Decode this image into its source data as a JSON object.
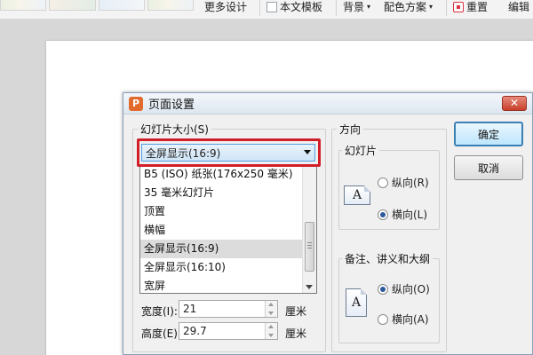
{
  "ribbon": {
    "more_designs": "更多设计",
    "text_template": "本文模板",
    "background": "背景",
    "color_scheme": "配色方案",
    "reset": "重置",
    "edit": "编辑"
  },
  "dialog": {
    "title": "页面设置",
    "close": "✕",
    "slide_size_group": "幻灯片大小(S)",
    "selected_size": "全屏显示(16:9)",
    "size_options": [
      "B5 (ISO) 纸张(176x250 毫米)",
      "35 毫米幻灯片",
      "顶置",
      "横幅",
      "全屏显示(16:9)",
      "全屏显示(16:10)",
      "宽屏"
    ],
    "selected_index": 4,
    "width_label": "宽度(I):",
    "width_value": "21",
    "width_unit": "厘米",
    "height_label": "高度(E):",
    "height_value": "29.7",
    "height_unit": "厘米",
    "orientation_group": "方向",
    "slides_subgroup": "幻灯片",
    "portrait": "纵向(R)",
    "landscape": "横向(L)",
    "notes_subgroup": "备注、讲义和大纲",
    "notes_portrait": "纵向(O)",
    "notes_landscape": "横向(A)",
    "ok": "确定",
    "cancel": "取消",
    "page_glyph": "A"
  }
}
